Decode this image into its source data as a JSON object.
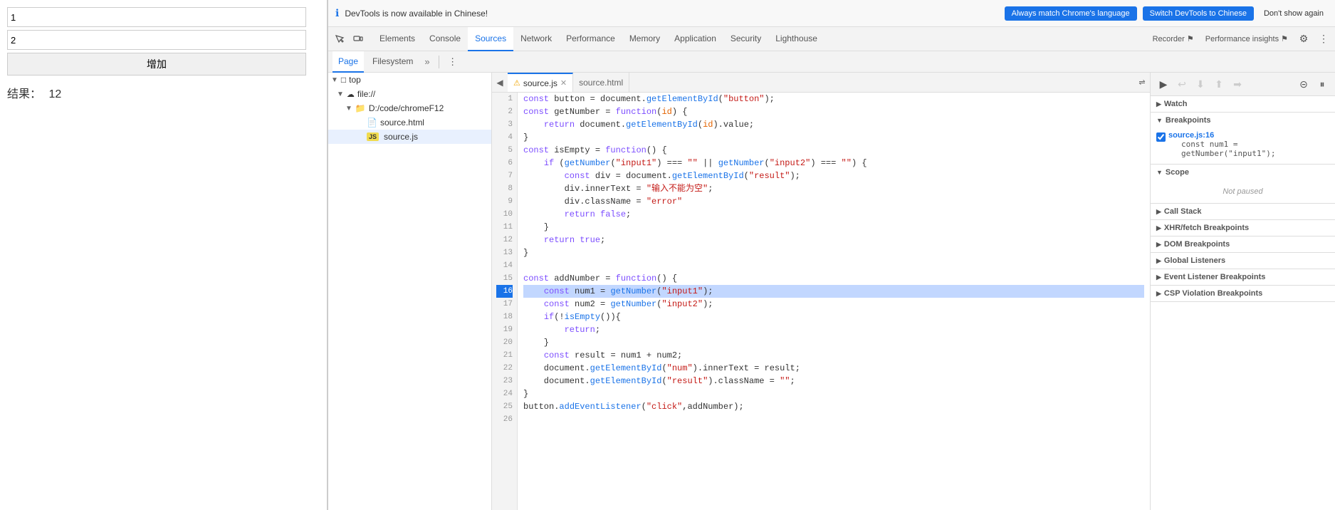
{
  "browser_page": {
    "input1_value": "1",
    "input2_value": "2",
    "button_label": "增加",
    "result_label": "结果：",
    "result_value": "12"
  },
  "notification": {
    "icon": "ℹ",
    "text": "DevTools is now available in Chinese!",
    "btn1": "Always match Chrome's language",
    "btn2": "Switch DevTools to Chinese",
    "btn3": "Don't show again"
  },
  "toolbar": {
    "tabs": [
      {
        "label": "Elements",
        "active": false
      },
      {
        "label": "Console",
        "active": false
      },
      {
        "label": "Sources",
        "active": true
      },
      {
        "label": "Network",
        "active": false
      },
      {
        "label": "Performance",
        "active": false
      },
      {
        "label": "Memory",
        "active": false
      },
      {
        "label": "Application",
        "active": false
      },
      {
        "label": "Security",
        "active": false
      },
      {
        "label": "Lighthouse",
        "active": false
      }
    ],
    "recorder_label": "Recorder ⚑",
    "perf_insights_label": "Performance insights ⚑"
  },
  "sub_toolbar": {
    "tab1": "Page",
    "tab2": "Filesystem",
    "more": "»"
  },
  "file_tree": {
    "top_label": "top",
    "filesystem_label": "file://",
    "folder_label": "D:/code/chromeF12",
    "files": [
      {
        "name": "source.html",
        "type": "html"
      },
      {
        "name": "source.js",
        "type": "js",
        "selected": true
      }
    ]
  },
  "file_tabs": [
    {
      "name": "source.js",
      "warning": true,
      "active": true
    },
    {
      "name": "source.html",
      "active": false
    }
  ],
  "code": {
    "lines": [
      {
        "n": 1,
        "text": "const button = document.getElementById(\"button\");"
      },
      {
        "n": 2,
        "text": "const getNumber = function(id) {"
      },
      {
        "n": 3,
        "text": "    return document.getElementById(id).value;"
      },
      {
        "n": 4,
        "text": "}"
      },
      {
        "n": 5,
        "text": "const isEmpty = function() {"
      },
      {
        "n": 6,
        "text": "    if (getNumber(\"input1\") === \"\" || getNumber(\"input2\") === \"\") {"
      },
      {
        "n": 7,
        "text": "        const div = document.getElementById(\"result\");"
      },
      {
        "n": 8,
        "text": "        div.innerText = \"输入不能为空\";"
      },
      {
        "n": 9,
        "text": "        div.className = \"error\""
      },
      {
        "n": 10,
        "text": "        return false;"
      },
      {
        "n": 11,
        "text": "    }"
      },
      {
        "n": 12,
        "text": "    return true;"
      },
      {
        "n": 13,
        "text": "}"
      },
      {
        "n": 14,
        "text": ""
      },
      {
        "n": 15,
        "text": "const addNumber = function() {"
      },
      {
        "n": 16,
        "text": "    const num1 = getNumber(\"input1\");",
        "highlighted": true
      },
      {
        "n": 17,
        "text": "    const num2 = getNumber(\"input2\");"
      },
      {
        "n": 18,
        "text": "    if(!isEmpty()){"
      },
      {
        "n": 19,
        "text": "        return;"
      },
      {
        "n": 20,
        "text": "    }"
      },
      {
        "n": 21,
        "text": "    const result = num1 + num2;"
      },
      {
        "n": 22,
        "text": "    document.getElementById(\"num\").innerText = result;"
      },
      {
        "n": 23,
        "text": "    document.getElementById(\"result\").className = \"\";"
      },
      {
        "n": 24,
        "text": "}"
      },
      {
        "n": 25,
        "text": "button.addEventListener(\"click\",addNumber);"
      },
      {
        "n": 26,
        "text": ""
      }
    ]
  },
  "right_panel": {
    "watch_label": "Watch",
    "breakpoints_label": "Breakpoints",
    "breakpoint_location": "source.js:16",
    "breakpoint_code": "const num1 = getNumber(\"input1\");",
    "scope_label": "Scope",
    "not_paused": "Not paused",
    "call_stack_label": "Call Stack",
    "xhr_label": "XHR/fetch Breakpoints",
    "dom_label": "DOM Breakpoints",
    "global_listeners_label": "Global Listeners",
    "event_listeners_label": "Event Listener Breakpoints",
    "csp_label": "CSP Violation Breakpoints"
  },
  "debug_buttons": {
    "pause": "⏸",
    "step_over": "↩",
    "step_into": "⬇",
    "step_out": "⬆",
    "step": "➡",
    "deactivate": "⊝",
    "pause_on_exception": "⏸"
  }
}
